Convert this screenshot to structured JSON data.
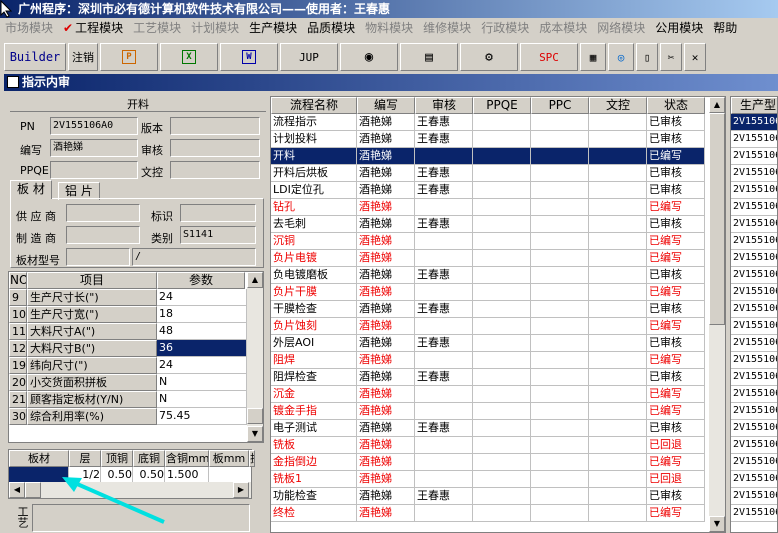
{
  "window": {
    "title": "广州程序：深圳市必有德计算机软件技术有限公司——使用者：王春惠"
  },
  "menu": [
    {
      "label": "市场模块",
      "active": false
    },
    {
      "label": "工程模块",
      "active": true
    },
    {
      "label": "工艺模块",
      "active": false
    },
    {
      "label": "计划模块",
      "active": false
    },
    {
      "label": "生产模块",
      "active": true
    },
    {
      "label": "品质模块",
      "active": true
    },
    {
      "label": "物料模块",
      "active": false
    },
    {
      "label": "维修模块",
      "active": false
    },
    {
      "label": "行政模块",
      "active": false
    },
    {
      "label": "成本模块",
      "active": false
    },
    {
      "label": "网络模块",
      "active": false
    },
    {
      "label": "公用模块",
      "active": true
    },
    {
      "label": "帮助",
      "active": true
    }
  ],
  "toolbar": {
    "builder": "Builder",
    "logout": "注销",
    "jup": "JUP",
    "spc": "SPC"
  },
  "subwindow": {
    "title": "指示内审"
  },
  "form": {
    "section_title": "开料",
    "pn_label": "PN",
    "pn_value": "2V155106A0",
    "version_label": "版本",
    "version_value": "",
    "writer_label": "编写",
    "writer_value": "酒艳娣",
    "review_label": "审核",
    "review_value": "",
    "ppqe_label": "PPQE",
    "ppqe_value": "",
    "doc_label": "文控",
    "doc_value": "",
    "tabs": [
      "板 材",
      "铝 片"
    ],
    "supplier_label": "供 应 商",
    "supplier_value": "",
    "mark_label": "标识",
    "mark_value": "",
    "maker_label": "制 造 商",
    "maker_value": "",
    "category_label": "类别",
    "category_value": "S1141",
    "model_label": "板材型号",
    "model_value": "",
    "model_value2": "/"
  },
  "params": {
    "headers": [
      "NO",
      "项目",
      "参数"
    ],
    "rows": [
      {
        "no": "9",
        "item": "生产尺寸长(\")",
        "val": "24"
      },
      {
        "no": "10",
        "item": "生产尺寸宽(\")",
        "val": "18"
      },
      {
        "no": "11",
        "item": "大料尺寸A(\")",
        "val": "48"
      },
      {
        "no": "12",
        "item": "大料尺寸B(\")",
        "val": "36",
        "selected": true
      },
      {
        "no": "19",
        "item": "纬向尺寸(\")",
        "val": "24"
      },
      {
        "no": "20",
        "item": "小交货面积拼板",
        "val": "N"
      },
      {
        "no": "21",
        "item": "顾客指定板材(Y/N)",
        "val": "N"
      },
      {
        "no": "30",
        "item": "综合利用率(%)",
        "val": "75.45"
      }
    ]
  },
  "layers": {
    "headers": [
      "板材",
      "层",
      "顶铜",
      "底铜",
      "含铜mm",
      "板mm",
      "挂"
    ],
    "rows": [
      {
        "board": "",
        "layer": "1/2",
        "top": "0.50",
        "bottom": "0.50",
        "cu": "1.500"
      }
    ]
  },
  "bottom_label": "工艺",
  "flow": {
    "headers": [
      "流程名称",
      "编写",
      "审核",
      "PPQE",
      "PPC",
      "文控",
      "状态"
    ],
    "rows": [
      {
        "name": "流程指示",
        "writer": "酒艳娣",
        "reviewer": "王春惠",
        "status": "已审核",
        "red": false
      },
      {
        "name": "计划投料",
        "writer": "酒艳娣",
        "reviewer": "王春惠",
        "status": "已审核",
        "red": false
      },
      {
        "name": "开料",
        "writer": "酒艳娣",
        "reviewer": "",
        "status": "已编写",
        "red": true,
        "selected": true
      },
      {
        "name": "开料后烘板",
        "writer": "酒艳娣",
        "reviewer": "王春惠",
        "status": "已审核",
        "red": false
      },
      {
        "name": "LDI定位孔",
        "writer": "酒艳娣",
        "reviewer": "王春惠",
        "status": "已审核",
        "red": false
      },
      {
        "name": "钻孔",
        "writer": "酒艳娣",
        "reviewer": "",
        "status": "已编写",
        "red": true
      },
      {
        "name": "去毛刺",
        "writer": "酒艳娣",
        "reviewer": "王春惠",
        "status": "已审核",
        "red": false
      },
      {
        "name": "沉铜",
        "writer": "酒艳娣",
        "reviewer": "",
        "status": "已编写",
        "red": true
      },
      {
        "name": "负片电镀",
        "writer": "酒艳娣",
        "reviewer": "",
        "status": "已编写",
        "red": true
      },
      {
        "name": "负电镀磨板",
        "writer": "酒艳娣",
        "reviewer": "王春惠",
        "status": "已审核",
        "red": false
      },
      {
        "name": "负片干膜",
        "writer": "酒艳娣",
        "reviewer": "",
        "status": "已编写",
        "red": true
      },
      {
        "name": "干膜检查",
        "writer": "酒艳娣",
        "reviewer": "王春惠",
        "status": "已审核",
        "red": false
      },
      {
        "name": "负片蚀刻",
        "writer": "酒艳娣",
        "reviewer": "",
        "status": "已编写",
        "red": true
      },
      {
        "name": "外层AOI",
        "writer": "酒艳娣",
        "reviewer": "王春惠",
        "status": "已审核",
        "red": false
      },
      {
        "name": "阻焊",
        "writer": "酒艳娣",
        "reviewer": "",
        "status": "已编写",
        "red": true
      },
      {
        "name": "阻焊检查",
        "writer": "酒艳娣",
        "reviewer": "王春惠",
        "status": "已审核",
        "red": false
      },
      {
        "name": "沉金",
        "writer": "酒艳娣",
        "reviewer": "",
        "status": "已编写",
        "red": true
      },
      {
        "name": "镀金手指",
        "writer": "酒艳娣",
        "reviewer": "",
        "status": "已编写",
        "red": true
      },
      {
        "name": "电子测试",
        "writer": "酒艳娣",
        "reviewer": "王春惠",
        "status": "已审核",
        "red": false
      },
      {
        "name": "铣板",
        "writer": "酒艳娣",
        "reviewer": "",
        "status": "已回退",
        "red": true
      },
      {
        "name": "金指倒边",
        "writer": "酒艳娣",
        "reviewer": "",
        "status": "已编写",
        "red": true
      },
      {
        "name": "铣板1",
        "writer": "酒艳娣",
        "reviewer": "",
        "status": "已回退",
        "red": true
      },
      {
        "name": "功能检查",
        "writer": "酒艳娣",
        "reviewer": "王春惠",
        "status": "已审核",
        "red": false
      },
      {
        "name": "终检",
        "writer": "酒艳娣",
        "reviewer": "",
        "status": "已编写",
        "red": true
      }
    ]
  },
  "side": {
    "header": "生产型",
    "rows": [
      "2V155106",
      "2V155106",
      "2V155106",
      "2V155106",
      "2V155106",
      "2V155106",
      "2V155106",
      "2V155106",
      "2V155106",
      "2V155106",
      "2V155106",
      "2V155106",
      "2V155106",
      "2V155106",
      "2V155106",
      "2V155106",
      "2V155106",
      "2V155106",
      "2V155106",
      "2V155106",
      "2V155106",
      "2V155106",
      "2V155106",
      "2V155106"
    ]
  },
  "colors": {
    "title_bar": "#0a246a",
    "selection": "#0a246a",
    "status_red": "#e00000",
    "annotation_arrow": "#00e0e0"
  }
}
